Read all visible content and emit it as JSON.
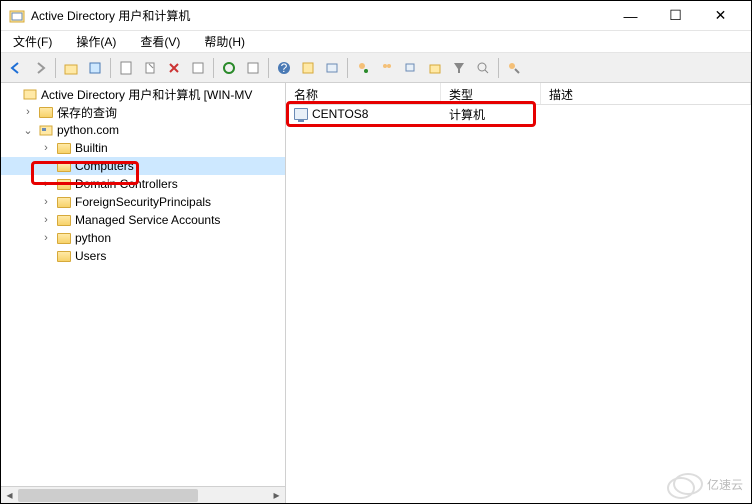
{
  "window": {
    "title": "Active Directory 用户和计算机"
  },
  "menu": {
    "file": "文件(F)",
    "action": "操作(A)",
    "view": "查看(V)",
    "help": "帮助(H)"
  },
  "tree": {
    "root": "Active Directory 用户和计算机 [WIN-MV",
    "savedQueries": "保存的查询",
    "domain": "python.com",
    "builtin": "Builtin",
    "computers": "Computers",
    "domainControllers": "Domain Controllers",
    "fsp": "ForeignSecurityPrincipals",
    "msa": "Managed Service Accounts",
    "python": "python",
    "users": "Users"
  },
  "list": {
    "columns": {
      "name": "名称",
      "type": "类型",
      "desc": "描述"
    },
    "rows": [
      {
        "name": "CENTOS8",
        "type": "计算机",
        "desc": ""
      }
    ]
  },
  "watermark": "亿速云"
}
